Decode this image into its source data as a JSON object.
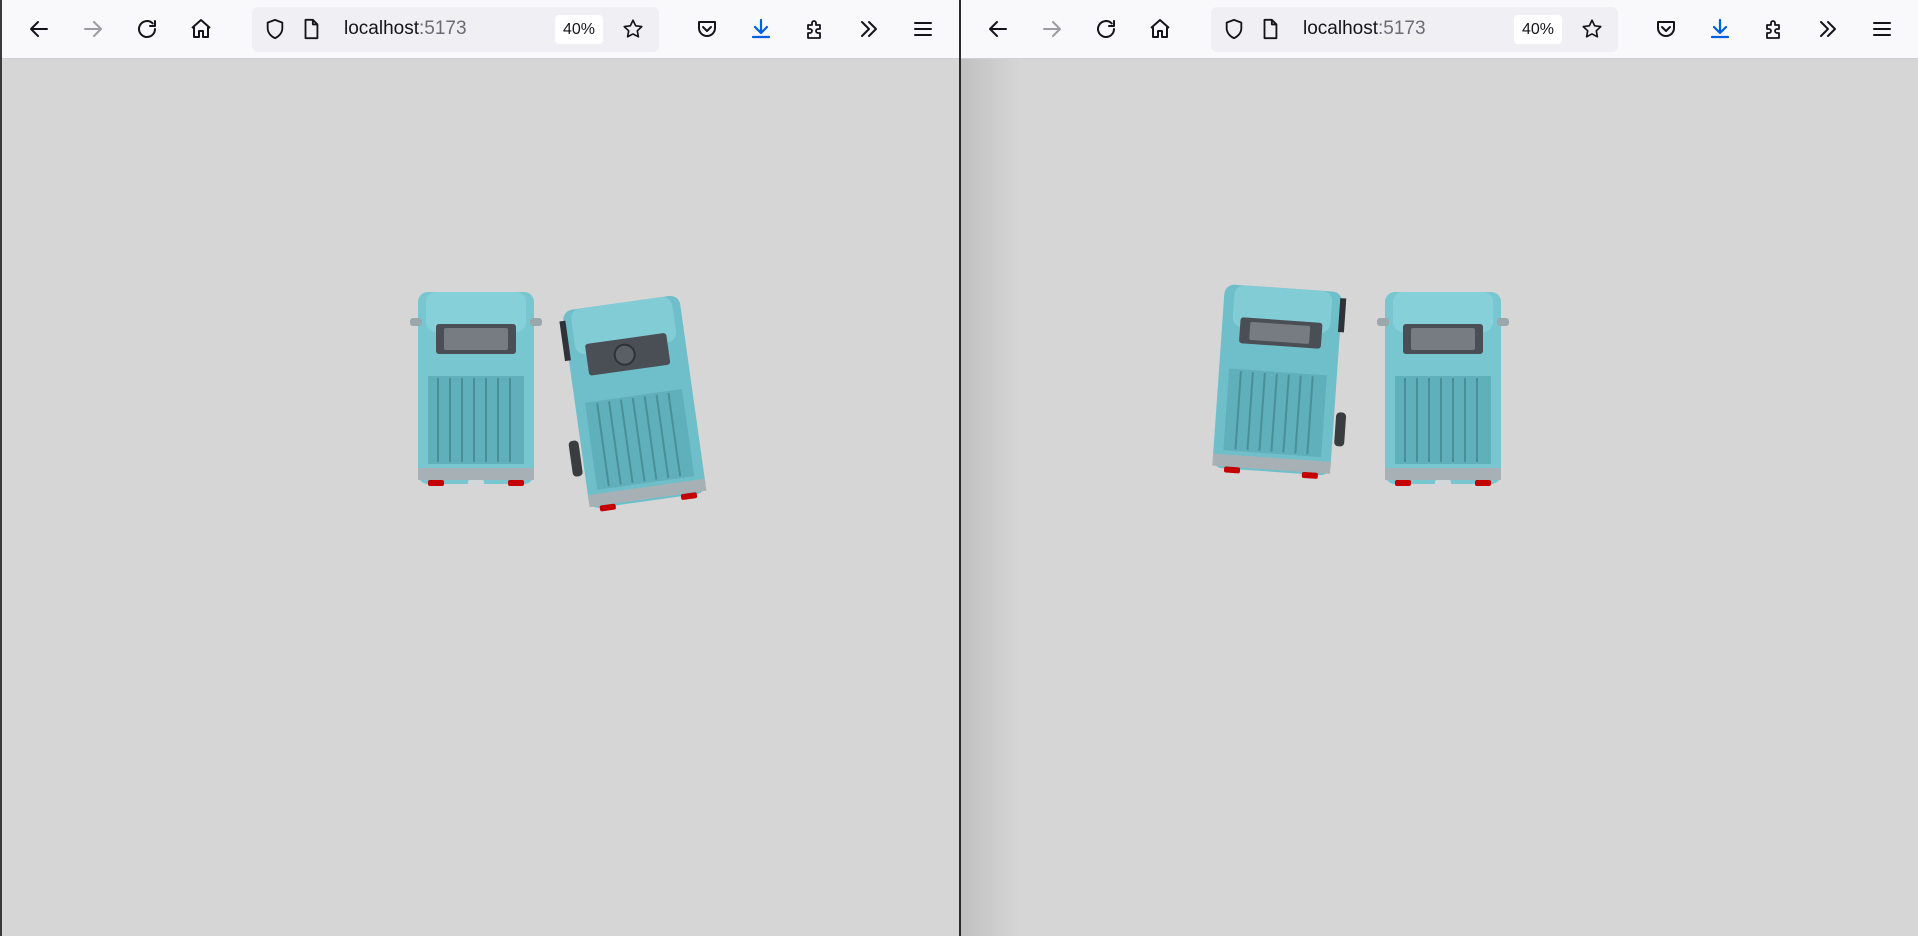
{
  "colors": {
    "toolbar_bg": "#f9f9fb",
    "urlbar_bg": "#f0f0f4",
    "viewport_bg": "#d6d6d6",
    "truck_body": "#77c6d0",
    "truck_shade": "#5fb0bb",
    "truck_dark": "#3e8d97",
    "taillight": "#c40000",
    "accent_download": "#0060df"
  },
  "windows": [
    {
      "url_host": "localhost",
      "url_port": ":5173",
      "zoom": "40%",
      "icons": {
        "back": "back-arrow-icon",
        "forward": "forward-arrow-icon",
        "reload": "reload-icon",
        "home": "home-icon",
        "shield": "tracking-protection-shield-icon",
        "page": "page-info-icon",
        "bookmark": "bookmark-star-icon",
        "pocket": "pocket-icon",
        "downloads": "download-icon",
        "extensions": "extensions-puzzle-icon",
        "overflow": "overflow-chevrons-icon",
        "menu": "hamburger-menu-icon"
      }
    },
    {
      "url_host": "localhost",
      "url_port": ":5173",
      "zoom": "40%",
      "icons": {
        "back": "back-arrow-icon",
        "forward": "forward-arrow-icon",
        "reload": "reload-icon",
        "home": "home-icon",
        "shield": "tracking-protection-shield-icon",
        "page": "page-info-icon",
        "bookmark": "bookmark-star-icon",
        "pocket": "pocket-icon",
        "downloads": "download-icon",
        "extensions": "extensions-puzzle-icon",
        "overflow": "overflow-chevrons-icon",
        "menu": "hamburger-menu-icon"
      }
    }
  ]
}
